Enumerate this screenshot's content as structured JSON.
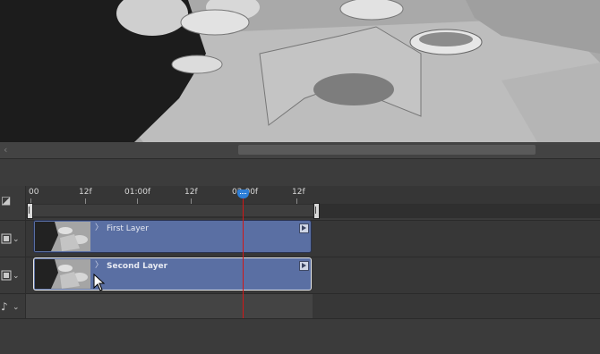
{
  "preview": {
    "description_icon": "video-frame"
  },
  "scrollbar": {
    "left_arrow": "‹"
  },
  "ruler": {
    "labels": [
      "00",
      "12f",
      "01:00f",
      "12f",
      "02:00f",
      "12f"
    ]
  },
  "tracks": [
    {
      "icon": "film-icon",
      "clip_name": "First Layer"
    },
    {
      "icon": "film-icon",
      "clip_name": "Second Layer"
    },
    {
      "icon": "music-note-icon"
    }
  ],
  "header": {
    "corner_icon": "◪"
  }
}
